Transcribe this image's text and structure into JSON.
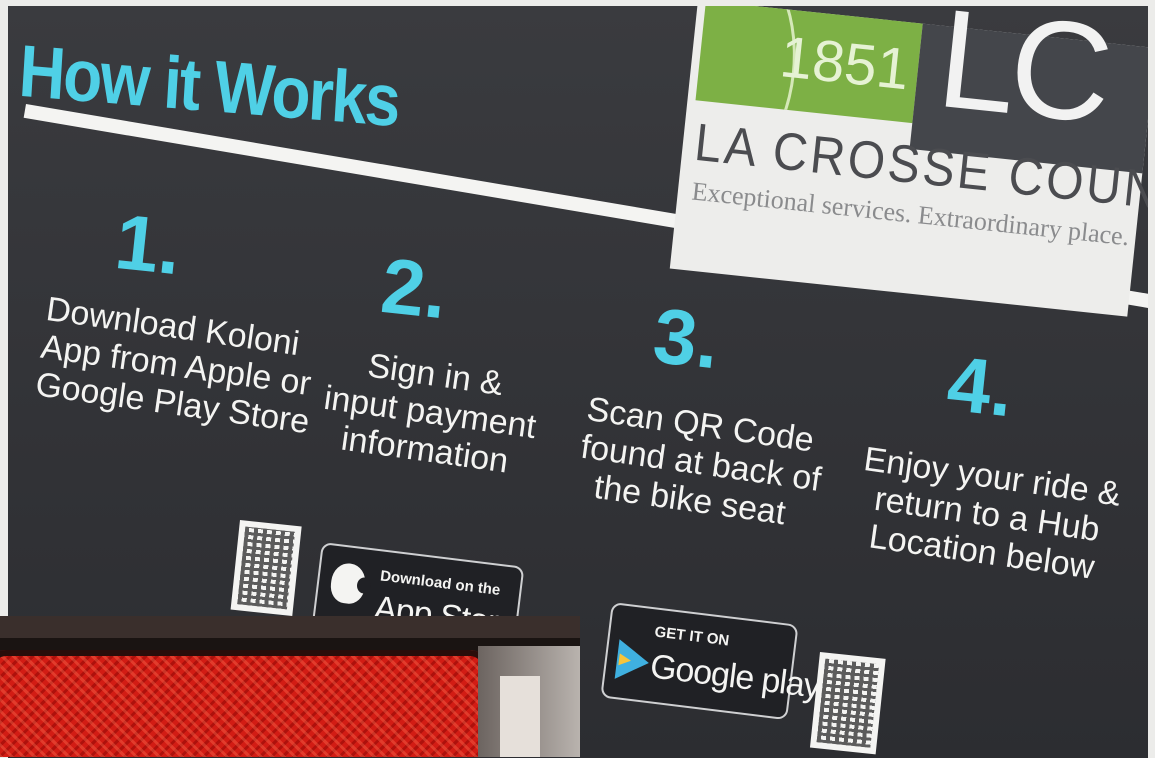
{
  "sign": {
    "title": "How it Works",
    "logo": {
      "year": "1851",
      "mark": "LC",
      "name": "LA CROSSE COUNTY",
      "tagline": "Exceptional services. Extraordinary place."
    },
    "steps": [
      {
        "number": "1.",
        "lines": [
          "Download Koloni",
          "App from Apple or",
          "Google Play Store"
        ]
      },
      {
        "number": "2.",
        "lines": [
          "Sign in &",
          "input payment",
          "information"
        ]
      },
      {
        "number": "3.",
        "lines": [
          "Scan QR Code",
          "found at back of",
          "the bike seat"
        ]
      },
      {
        "number": "4.",
        "lines": [
          "Enjoy your ride &",
          "return to a Hub",
          "Location below"
        ]
      }
    ],
    "badges": {
      "app_store_small": "Download on the",
      "app_store_big": "App Store",
      "google_small": "GET IT ON",
      "google_big": "Google play"
    }
  },
  "colors": {
    "accent": "#4fd0e6",
    "panel": "#343539",
    "reflector": "#d21c14"
  }
}
